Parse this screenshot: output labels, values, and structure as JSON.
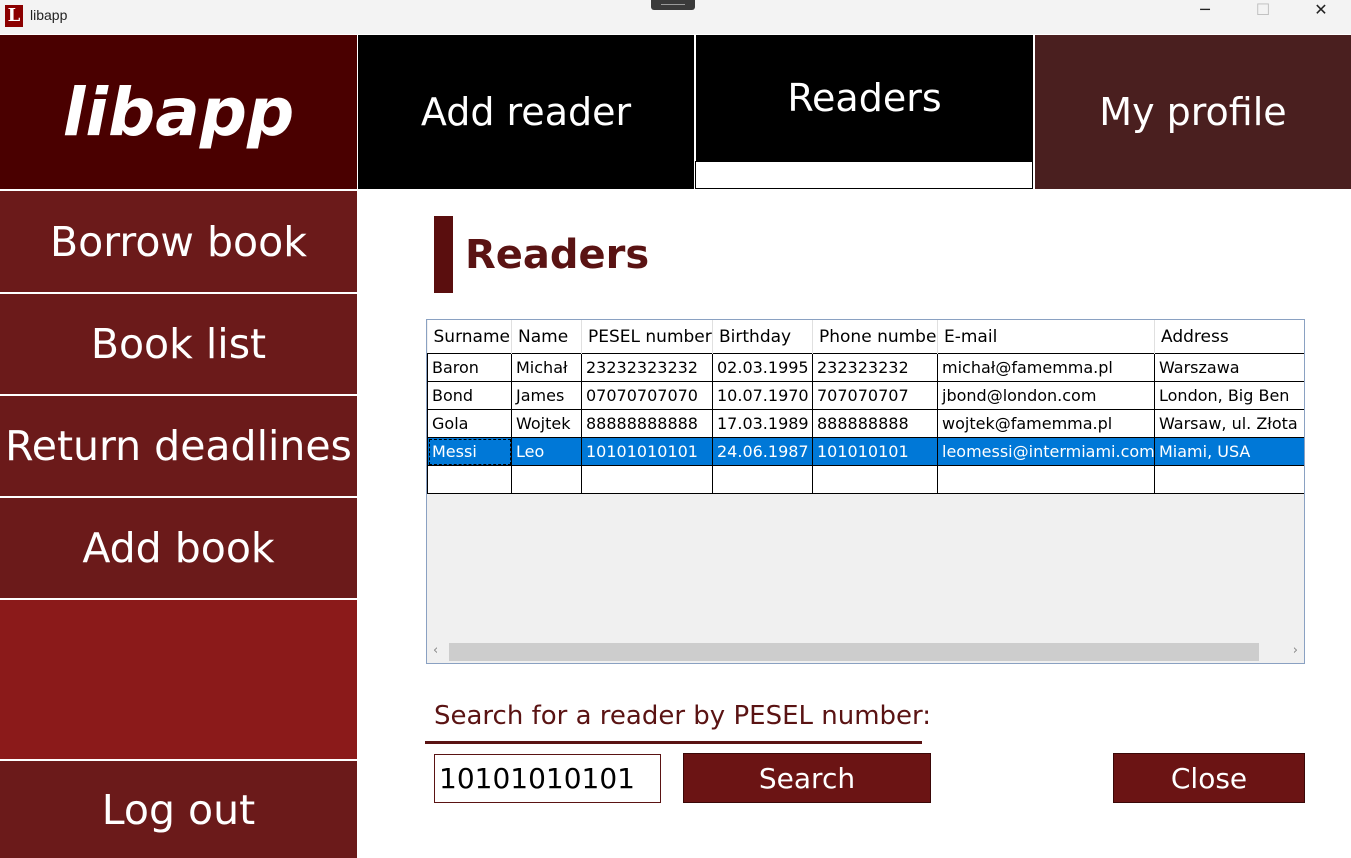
{
  "window": {
    "title": "libapp",
    "icon_letter": "L",
    "minimize": "─",
    "maximize": "☐",
    "close": "✕"
  },
  "logo": "libapp",
  "topnav": {
    "add_reader": "Add reader",
    "readers": "Readers",
    "my_profile": "My profile",
    "active": "Readers"
  },
  "sidebar": {
    "items": [
      {
        "label": "Borrow book"
      },
      {
        "label": "Book list"
      },
      {
        "label": "Return deadlines"
      },
      {
        "label": "Add book"
      }
    ],
    "logout": "Log out"
  },
  "main": {
    "heading": "Readers",
    "table": {
      "columns": [
        "Surname",
        "Name",
        "PESEL number",
        "Birthday",
        "Phone number",
        "E-mail",
        "Address"
      ],
      "rows": [
        [
          "Baron",
          "Michał",
          "23232323232",
          "02.03.1995",
          "232323232",
          "michał@famemma.pl",
          "Warszawa"
        ],
        [
          "Bond",
          "James",
          "07070707070",
          "10.07.1970",
          "707070707",
          "jbond@london.com",
          "London, Big Ben"
        ],
        [
          "Gola",
          "Wojtek",
          "88888888888",
          "17.03.1989",
          "888888888",
          "wojtek@famemma.pl",
          "Warsaw, ul. Złota"
        ],
        [
          "Messi",
          "Leo",
          "10101010101",
          "24.06.1987",
          "101010101",
          "leomessi@intermiami.com",
          "Miami, USA"
        ]
      ],
      "selected_row": 3,
      "scroll_left": "‹",
      "scroll_right": "›"
    },
    "search": {
      "label": "Search for a reader by PESEL number:",
      "value": "10101010101",
      "button": "Search"
    },
    "close_button": "Close"
  },
  "colors": {
    "logo_bg": "#4a0000",
    "sidebar_item": "#6b1a1a",
    "sidebar_filler": "#8b1a1a",
    "topnav_active": "#000000",
    "topnav_profile": "#4a1f1f",
    "accent": "#5a1313",
    "selection": "#0078d7"
  }
}
